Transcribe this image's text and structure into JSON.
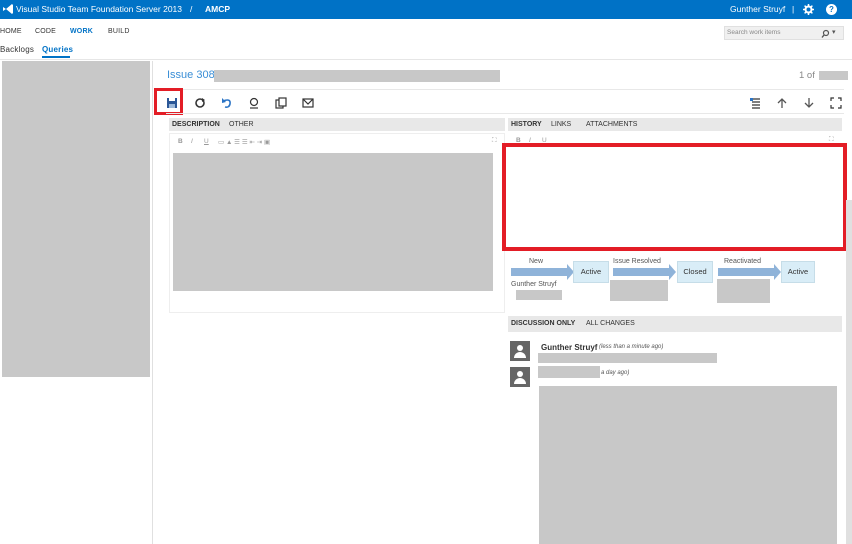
{
  "topbar": {
    "product_title": "Visual Studio Team Foundation Server 2013",
    "separator": "/",
    "project": "AMCP",
    "user": "Gunther Struyf",
    "divider": "|",
    "help_icon": "?"
  },
  "nav": {
    "items": [
      "HOME",
      "CODE",
      "WORK",
      "BUILD"
    ],
    "active": "WORK",
    "subitems": [
      "Backlogs",
      "Queries"
    ],
    "active_sub": "Queries",
    "search_placeholder": "Search work items"
  },
  "workitem": {
    "title": "Issue 3088",
    "pager": "1 of"
  },
  "toolbar": {
    "icons": [
      "save-icon",
      "refresh-icon",
      "undo-icon",
      "link-icon",
      "copy-icon",
      "email-icon"
    ],
    "right_icons": [
      "links-icon",
      "up-icon",
      "down-icon",
      "fullscreen-icon"
    ]
  },
  "left_tabs": [
    "DESCRIPTION",
    "OTHER"
  ],
  "right_tabs": [
    "HISTORY",
    "LINKS",
    "ATTACHMENTS"
  ],
  "format_buttons": [
    "B",
    "I",
    "U"
  ],
  "state_flow": {
    "transitions": [
      "New",
      "Issue Resolved",
      "Reactivated"
    ],
    "states": [
      "Active",
      "Closed",
      "Active"
    ],
    "first_author": "Gunther Struyf"
  },
  "discussion": {
    "tabs": [
      "DISCUSSION ONLY",
      "ALL CHANGES"
    ],
    "entries": [
      {
        "author": "Gunther Struyf",
        "time": "(less than a minute ago)"
      },
      {
        "time": "a day ago)"
      }
    ]
  },
  "colors": {
    "brand": "#0072c6",
    "highlight": "#e31d26",
    "state_box": "#d9edf7",
    "arrow": "#8fb3d9"
  }
}
